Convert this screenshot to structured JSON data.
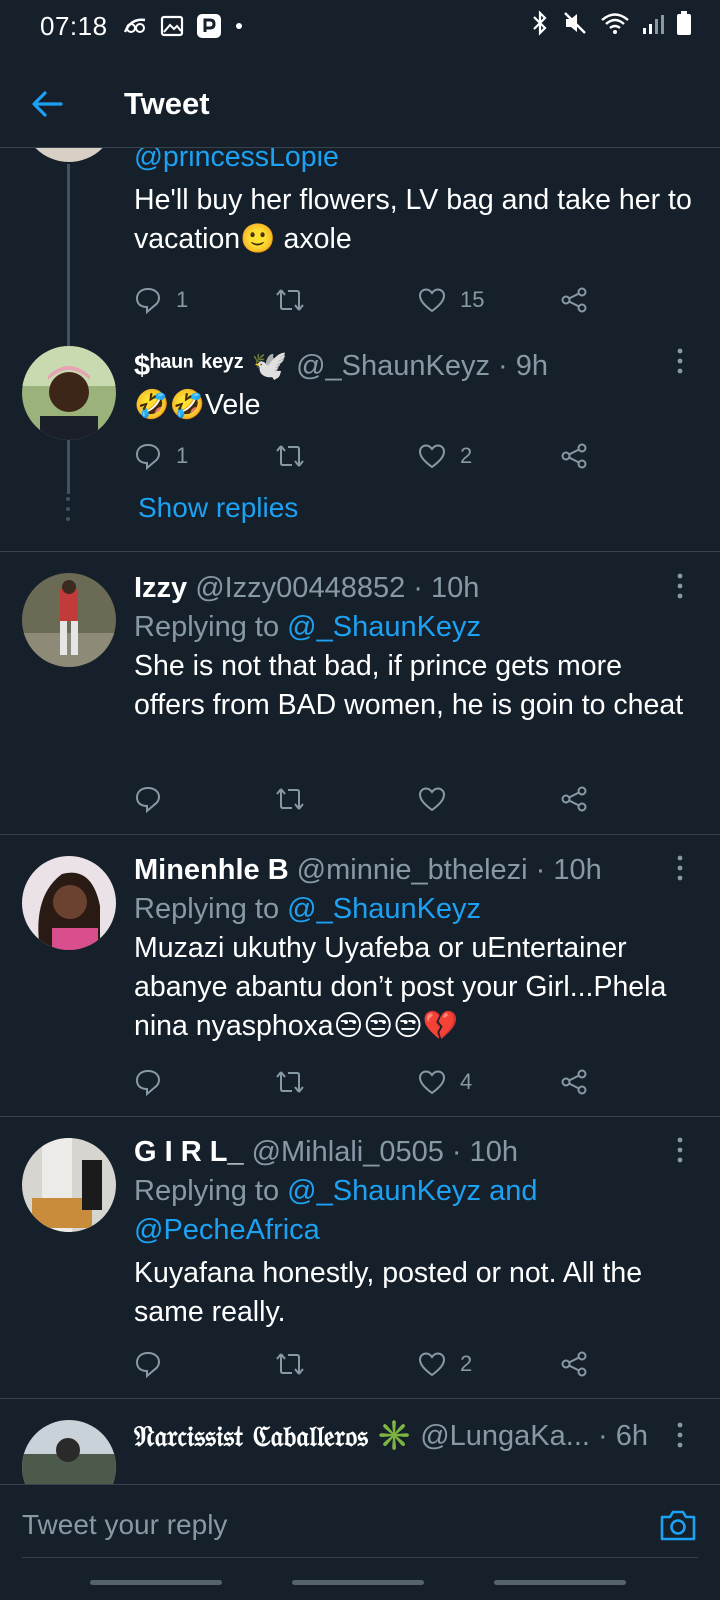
{
  "status_bar": {
    "time": "07:18"
  },
  "header": {
    "title": "Tweet"
  },
  "tweets": [
    {
      "mention_top": "@princessLopie",
      "text": "He'll buy her flowers, LV bag and take her to vacation🙂 axole",
      "reply_count": "1",
      "retweet_count": "",
      "like_count": "15"
    },
    {
      "name": "$ʰᵃᵘⁿ ᵏᵉʸᶻ",
      "handle": "🕊️ @_ShaunKeyz · 9h",
      "text": "🤣🤣Vele",
      "reply_count": "1",
      "like_count": "2",
      "show_replies": "Show replies"
    },
    {
      "name": "Izzy",
      "handle": "@Izzy00448852 · 10h",
      "replying_prefix": "Replying to",
      "replying_to": "@_ShaunKeyz",
      "text": "She is not that bad, if prince gets more offers from BAD women, he is goin to cheat",
      "reply_count": "",
      "like_count": ""
    },
    {
      "name": "Minenhle B",
      "handle": "@minnie_bthelezi · 10h",
      "replying_prefix": "Replying to",
      "replying_to": "@_ShaunKeyz",
      "text": "Muzazi ukuthy Uyafeba or uEntertainer abanye abantu don’t post your Girl...Phela nina nyasphoxa😒😒😒💔",
      "reply_count": "",
      "like_count": "4"
    },
    {
      "name": "G I R L_",
      "handle": "@Mihlali_0505 · 10h",
      "replying_prefix": "Replying to",
      "replying_to": "@_ShaunKeyz and @PecheAfrica",
      "text": "Kuyafana honestly, posted or not. All the same really.",
      "reply_count": "",
      "like_count": "2"
    },
    {
      "name": "𝔑𝔞𝔯𝔠𝔦𝔰𝔰𝔦𝔰𝔱 ℭ𝔞𝔟𝔞𝔩𝔩𝔢𝔯𝔬𝔰",
      "handle": "✳️ @LungaKa... · 6h"
    }
  ],
  "reply_bar": {
    "placeholder": "Tweet your reply"
  },
  "colors": {
    "background": "#15202b",
    "accent": "#1da1f2",
    "muted": "#8899a6",
    "divider": "#38444d"
  }
}
